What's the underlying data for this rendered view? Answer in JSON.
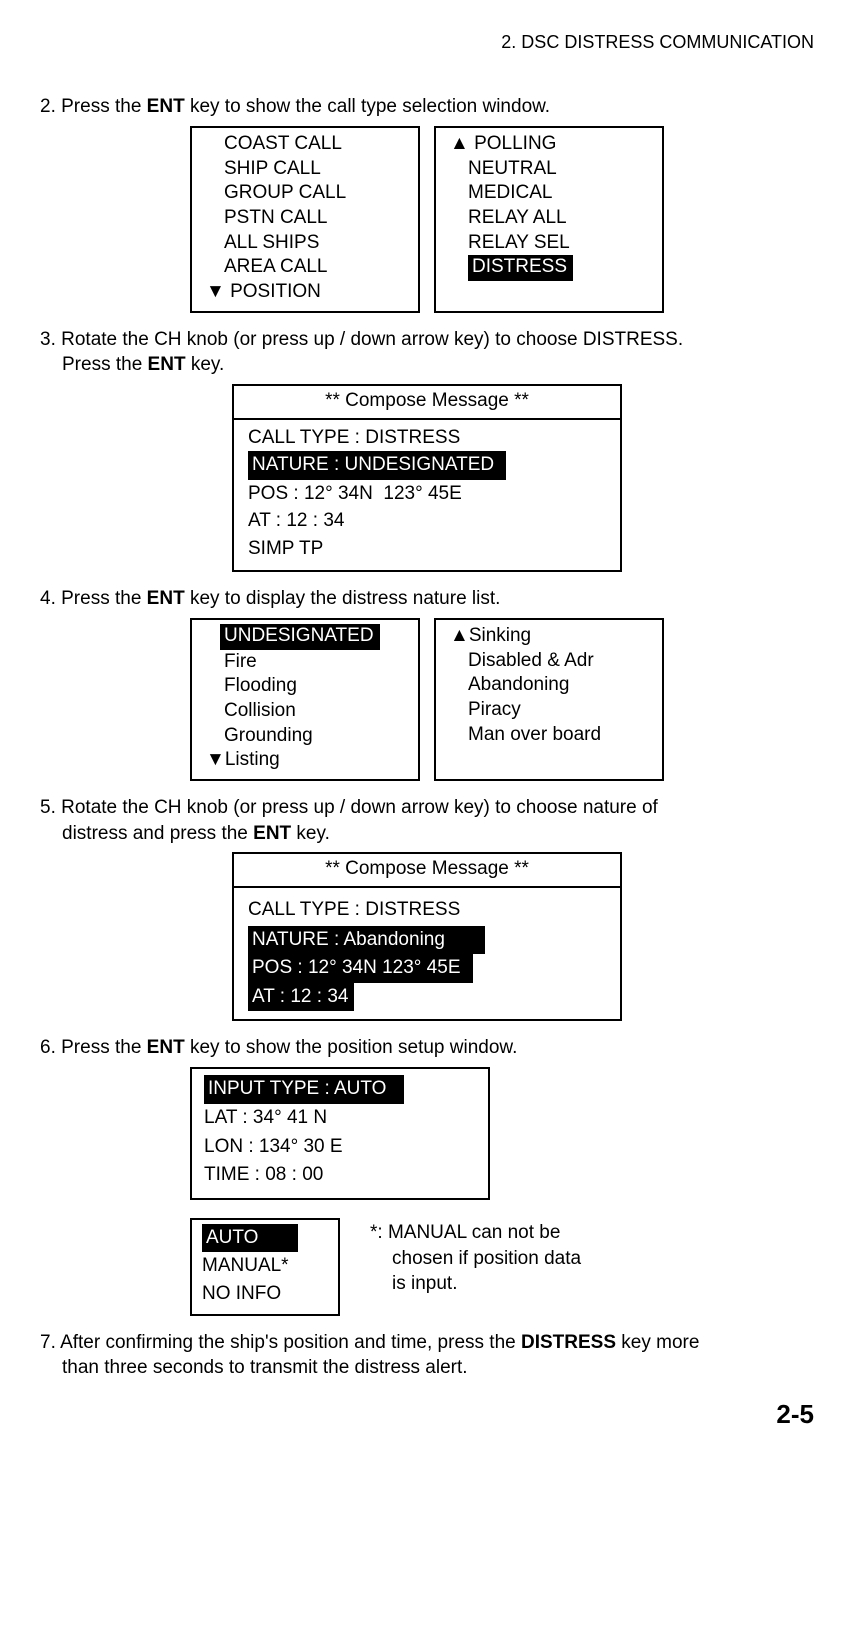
{
  "header": "2. DSC DISTRESS COMMUNICATION",
  "step2": {
    "prefix": "2. Press the ",
    "key": "ENT",
    "suffix": " key to show the call type selection window."
  },
  "callTypeLeft": [
    "COAST CALL",
    "SHIP CALL",
    "GROUP CALL",
    "PSTN CALL",
    "ALL SHIPS",
    "AREA CALL"
  ],
  "callTypeLeftLast": "POSITION",
  "callTypeRight": [
    "POLLING",
    "NEUTRAL",
    "MEDICAL",
    "RELAY ALL",
    "RELAY SEL"
  ],
  "callTypeRightHighlight": "DISTRESS",
  "step3": {
    "line1": "3. Rotate the CH knob (or press up / down arrow key) to choose DISTRESS.",
    "line2_prefix": "Press the ",
    "line2_key": "ENT",
    "line2_suffix": " key."
  },
  "compose1": {
    "title": "** Compose Message **",
    "line1": "CALL TYPE : DISTRESS",
    "highlight": "NATURE : UNDESIGNATED",
    "line3": "POS : 12° 34N  123° 45E",
    "line4": "AT : 12 : 34",
    "line5": "SIMP TP"
  },
  "step4": {
    "prefix": "4. Press the ",
    "key": "ENT",
    "suffix": " key to display the distress nature list."
  },
  "natureLeft": {
    "highlight": "UNDESIGNATED",
    "items": [
      "Fire",
      "Flooding",
      "Collision",
      "Grounding"
    ],
    "last": "Listing"
  },
  "natureRight": {
    "first": "Sinking",
    "items": [
      "Disabled & Adr",
      "Abandoning",
      "Piracy",
      "Man over board"
    ]
  },
  "step5": {
    "line1": "5. Rotate the CH knob (or press up / down arrow key) to choose nature of",
    "line2_prefix": "distress and press the ",
    "line2_key": "ENT",
    "line2_suffix": " key."
  },
  "compose2": {
    "title": "** Compose Message **",
    "line1": "CALL TYPE : DISTRESS",
    "hl1": "NATURE : Abandoning",
    "hl2": "POS : 12° 34N  123° 45E",
    "hl3": "AT : 12 : 34"
  },
  "step6": {
    "prefix": "6. Press the ",
    "key": "ENT",
    "suffix": " key to show the position setup window."
  },
  "posSetup": {
    "highlight": "INPUT TYPE : AUTO",
    "lat": "LAT : 34° 41 N",
    "lon": "LON : 134°  30 E",
    "time": "TIME : 08 : 00"
  },
  "inputType": {
    "highlight": "AUTO",
    "opt2": "MANUAL*",
    "opt3": "NO INFO"
  },
  "note": {
    "l1": "*: MANUAL can not be",
    "l2": "chosen if position data",
    "l3": "is input."
  },
  "step7": {
    "l1_a": "7. After confirming the ship's position and time, press the ",
    "l1_key": "DISTRESS",
    "l1_b": " key more",
    "l2": "than three seconds to transmit the distress alert."
  },
  "pageNum": "2-5"
}
